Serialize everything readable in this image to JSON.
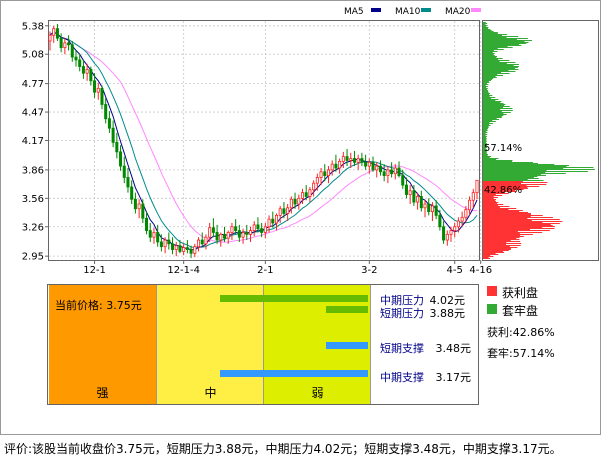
{
  "legend": {
    "ma5": {
      "label": "MA5",
      "color": "#00008b"
    },
    "ma10": {
      "label": "MA10",
      "color": "#008b8b"
    },
    "ma20": {
      "label": "MA20",
      "color": "#ff88ff"
    }
  },
  "chart_data": {
    "type": "candlestick",
    "y_ticks": [
      "5.38",
      "5.08",
      "4.77",
      "4.47",
      "4.17",
      "3.86",
      "3.56",
      "3.26",
      "2.95"
    ],
    "y_range": [
      2.92,
      5.42
    ],
    "x_ticks": [
      {
        "label": "12-1",
        "i": 12
      },
      {
        "label": "12-1-4",
        "i": 36
      },
      {
        "label": "2-1",
        "i": 58
      },
      {
        "label": "3-2",
        "i": 86
      },
      {
        "label": "4-5",
        "i": 109
      },
      {
        "label": "4-16",
        "i": 116
      }
    ],
    "ohlc": [
      [
        5.22,
        5.32,
        5.12,
        5.28
      ],
      [
        5.28,
        5.38,
        5.2,
        5.35
      ],
      [
        5.35,
        5.4,
        5.22,
        5.25
      ],
      [
        5.25,
        5.3,
        5.1,
        5.15
      ],
      [
        5.15,
        5.25,
        5.08,
        5.2
      ],
      [
        5.2,
        5.28,
        5.12,
        5.18
      ],
      [
        5.18,
        5.22,
        5.0,
        5.05
      ],
      [
        5.05,
        5.12,
        4.95,
        5.02
      ],
      [
        5.02,
        5.08,
        4.9,
        4.95
      ],
      [
        4.95,
        5.02,
        4.82,
        4.88
      ],
      [
        4.88,
        4.98,
        4.8,
        4.92
      ],
      [
        4.92,
        4.95,
        4.75,
        4.8
      ],
      [
        4.8,
        4.88,
        4.62,
        4.68
      ],
      [
        4.68,
        4.78,
        4.6,
        4.72
      ],
      [
        4.72,
        4.75,
        4.5,
        4.55
      ],
      [
        4.55,
        4.62,
        4.35,
        4.4
      ],
      [
        4.4,
        4.48,
        4.25,
        4.3
      ],
      [
        4.3,
        4.38,
        4.1,
        4.15
      ],
      [
        4.15,
        4.25,
        3.98,
        4.05
      ],
      [
        4.05,
        4.12,
        3.85,
        3.9
      ],
      [
        3.9,
        4.0,
        3.72,
        3.78
      ],
      [
        3.78,
        3.88,
        3.62,
        3.68
      ],
      [
        3.68,
        3.75,
        3.5,
        3.55
      ],
      [
        3.55,
        3.62,
        3.4,
        3.45
      ],
      [
        3.45,
        3.55,
        3.35,
        3.5
      ],
      [
        3.5,
        3.55,
        3.3,
        3.35
      ],
      [
        3.35,
        3.42,
        3.18,
        3.22
      ],
      [
        3.22,
        3.3,
        3.1,
        3.15
      ],
      [
        3.15,
        3.25,
        3.08,
        3.2
      ],
      [
        3.2,
        3.28,
        3.05,
        3.1
      ],
      [
        3.1,
        3.18,
        3.0,
        3.05
      ],
      [
        3.05,
        3.15,
        2.98,
        3.12
      ],
      [
        3.12,
        3.2,
        3.02,
        3.08
      ],
      [
        3.08,
        3.15,
        2.97,
        3.02
      ],
      [
        3.02,
        3.1,
        2.95,
        3.06
      ],
      [
        3.06,
        3.12,
        2.98,
        3.0
      ],
      [
        3.0,
        3.08,
        2.96,
        3.04
      ],
      [
        3.04,
        3.12,
        2.98,
        3.02
      ],
      [
        3.02,
        3.06,
        2.93,
        2.98
      ],
      [
        2.98,
        3.08,
        2.94,
        3.05
      ],
      [
        3.05,
        3.15,
        3.0,
        3.12
      ],
      [
        3.12,
        3.2,
        3.05,
        3.08
      ],
      [
        3.08,
        3.18,
        3.02,
        3.15
      ],
      [
        3.15,
        3.3,
        3.1,
        3.25
      ],
      [
        3.25,
        3.35,
        3.15,
        3.2
      ],
      [
        3.2,
        3.28,
        3.08,
        3.12
      ],
      [
        3.12,
        3.2,
        3.05,
        3.18
      ],
      [
        3.18,
        3.26,
        3.1,
        3.14
      ],
      [
        3.14,
        3.22,
        3.08,
        3.2
      ],
      [
        3.2,
        3.3,
        3.12,
        3.26
      ],
      [
        3.26,
        3.34,
        3.18,
        3.22
      ],
      [
        3.22,
        3.28,
        3.1,
        3.15
      ],
      [
        3.15,
        3.24,
        3.08,
        3.2
      ],
      [
        3.2,
        3.28,
        3.12,
        3.18
      ],
      [
        3.18,
        3.26,
        3.1,
        3.22
      ],
      [
        3.22,
        3.32,
        3.16,
        3.28
      ],
      [
        3.28,
        3.36,
        3.2,
        3.24
      ],
      [
        3.24,
        3.3,
        3.15,
        3.2
      ],
      [
        3.2,
        3.3,
        3.14,
        3.26
      ],
      [
        3.26,
        3.38,
        3.2,
        3.34
      ],
      [
        3.34,
        3.42,
        3.25,
        3.3
      ],
      [
        3.3,
        3.4,
        3.22,
        3.38
      ],
      [
        3.38,
        3.48,
        3.3,
        3.45
      ],
      [
        3.45,
        3.52,
        3.35,
        3.4
      ],
      [
        3.4,
        3.5,
        3.32,
        3.46
      ],
      [
        3.46,
        3.58,
        3.4,
        3.55
      ],
      [
        3.55,
        3.62,
        3.45,
        3.5
      ],
      [
        3.5,
        3.6,
        3.44,
        3.56
      ],
      [
        3.56,
        3.66,
        3.5,
        3.62
      ],
      [
        3.62,
        3.7,
        3.54,
        3.58
      ],
      [
        3.58,
        3.68,
        3.52,
        3.65
      ],
      [
        3.65,
        3.75,
        3.58,
        3.72
      ],
      [
        3.72,
        3.82,
        3.64,
        3.78
      ],
      [
        3.78,
        3.88,
        3.7,
        3.84
      ],
      [
        3.84,
        3.92,
        3.74,
        3.8
      ],
      [
        3.8,
        3.9,
        3.72,
        3.86
      ],
      [
        3.86,
        3.96,
        3.8,
        3.92
      ],
      [
        3.92,
        4.02,
        3.84,
        3.88
      ],
      [
        3.88,
        3.98,
        3.82,
        3.95
      ],
      [
        3.95,
        4.05,
        3.88,
        4.0
      ],
      [
        4.0,
        4.08,
        3.9,
        3.96
      ],
      [
        3.96,
        4.04,
        3.88,
        3.98
      ],
      [
        3.98,
        4.06,
        3.9,
        3.94
      ],
      [
        3.94,
        4.02,
        3.86,
        3.98
      ],
      [
        3.98,
        4.04,
        3.9,
        3.94
      ],
      [
        3.94,
        4.02,
        3.86,
        3.9
      ],
      [
        3.9,
        3.98,
        3.82,
        3.94
      ],
      [
        3.94,
        4.0,
        3.84,
        3.86
      ],
      [
        3.86,
        3.94,
        3.78,
        3.9
      ],
      [
        3.9,
        3.96,
        3.8,
        3.84
      ],
      [
        3.84,
        3.92,
        3.74,
        3.8
      ],
      [
        3.8,
        3.9,
        3.72,
        3.86
      ],
      [
        3.86,
        3.94,
        3.78,
        3.82
      ],
      [
        3.82,
        3.92,
        3.76,
        3.88
      ],
      [
        3.88,
        3.95,
        3.78,
        3.8
      ],
      [
        3.8,
        3.86,
        3.66,
        3.7
      ],
      [
        3.7,
        3.78,
        3.56,
        3.6
      ],
      [
        3.6,
        3.7,
        3.5,
        3.64
      ],
      [
        3.64,
        3.7,
        3.48,
        3.52
      ],
      [
        3.52,
        3.62,
        3.44,
        3.58
      ],
      [
        3.58,
        3.64,
        3.42,
        3.46
      ],
      [
        3.46,
        3.54,
        3.36,
        3.5
      ],
      [
        3.5,
        3.56,
        3.38,
        3.42
      ],
      [
        3.42,
        3.52,
        3.32,
        3.48
      ],
      [
        3.48,
        3.54,
        3.34,
        3.38
      ],
      [
        3.38,
        3.44,
        3.22,
        3.26
      ],
      [
        3.26,
        3.32,
        3.08,
        3.12
      ],
      [
        3.12,
        3.22,
        3.06,
        3.18
      ],
      [
        3.18,
        3.26,
        3.1,
        3.22
      ],
      [
        3.22,
        3.3,
        3.15,
        3.26
      ],
      [
        3.26,
        3.36,
        3.2,
        3.32
      ],
      [
        3.32,
        3.42,
        3.26,
        3.36
      ],
      [
        3.36,
        3.48,
        3.3,
        3.44
      ],
      [
        3.44,
        3.58,
        3.38,
        3.54
      ],
      [
        3.54,
        3.66,
        3.46,
        3.62
      ],
      [
        3.62,
        3.74,
        3.55,
        3.75
      ]
    ]
  },
  "distribution": {
    "pct_trapped": "57.14%",
    "pct_profit": "42.86%",
    "profit_color": "#ff3333",
    "trapped_color": "#33aa33",
    "price_at_current": 3.75
  },
  "panel_legend": {
    "profit": {
      "label": "获利盘",
      "color": "#ff3333"
    },
    "trapped": {
      "label": "套牢盘",
      "color": "#33aa33"
    },
    "profit_line": "获利:42.86%",
    "trapped_line": "套牢:57.14%"
  },
  "zones": {
    "strong": {
      "label": "强",
      "color": "#ff9900"
    },
    "mid": {
      "label": "中",
      "color": "#ffee44"
    },
    "weak": {
      "label": "弱",
      "color": "#ddee00"
    }
  },
  "current_price": "当前价格: 3.75元",
  "levels": [
    {
      "name": "中期压力",
      "value": "4.02元",
      "bar_color": "#66bb00",
      "price": 4.02
    },
    {
      "name": "短期压力",
      "value": "3.88元",
      "bar_color": "#66bb00",
      "price": 3.88
    },
    {
      "name": "短期支撑",
      "value": "3.48元",
      "bar_color": "#3399ff",
      "price": 3.48
    },
    {
      "name": "中期支撑",
      "value": "3.17元",
      "bar_color": "#3399ff",
      "price": 3.17
    }
  ],
  "footer": "评价:该股当前收盘价3.75元，短期压力3.88元，中期压力4.02元；短期支撑3.48元，中期支撑3.17元。"
}
